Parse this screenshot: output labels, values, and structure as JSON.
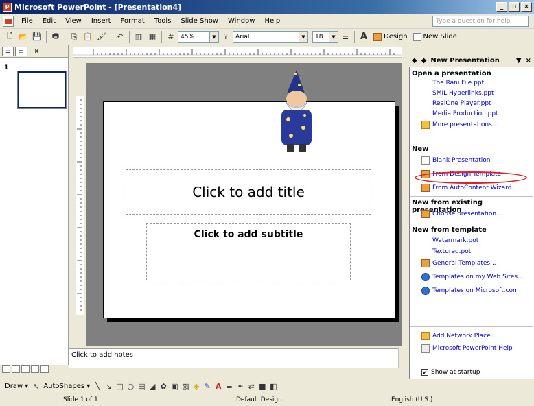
{
  "window": {
    "title": "Microsoft PowerPoint - [Presentation4]"
  },
  "menu": {
    "items": [
      "File",
      "Edit",
      "View",
      "Insert",
      "Format",
      "Tools",
      "Slide Show",
      "Window",
      "Help"
    ],
    "ask_placeholder": "Type a question for help"
  },
  "toolbar": {
    "zoom": "45%",
    "font": "Arial",
    "font_size": "18",
    "design_label": "Design",
    "new_slide_label": "New Slide"
  },
  "slide": {
    "title_placeholder": "Click to add title",
    "subtitle_placeholder": "Click to add subtitle",
    "thumbnail_number": "1"
  },
  "notes": {
    "placeholder": "Click to add notes"
  },
  "task_pane": {
    "title": "New Presentation",
    "open": {
      "heading": "Open a presentation",
      "files": [
        "The Rani File.ppt",
        "SMIL Hyperlinks.ppt",
        "RealOne Player.ppt",
        "Media Production.ppt"
      ],
      "more": "More presentations..."
    },
    "new": {
      "heading": "New",
      "blank": "Blank Presentation",
      "design_template": "From Design Template",
      "autocontent": "From AutoContent Wizard"
    },
    "existing": {
      "heading": "New from existing presentation",
      "choose": "Choose presentation..."
    },
    "template": {
      "heading": "New from template",
      "files": [
        "Watermark.pot",
        "Textured.pot"
      ],
      "general": "General Templates...",
      "web": "Templates on my Web Sites...",
      "microsoft": "Templates on Microsoft.com"
    },
    "bottom": {
      "network": "Add Network Place...",
      "help": "Microsoft PowerPoint Help",
      "startup": "Show at startup"
    }
  },
  "drawing": {
    "draw": "Draw",
    "autoshapes": "AutoShapes"
  },
  "status": {
    "slide": "Slide 1 of 1",
    "design": "Default Design",
    "language": "English (U.S.)"
  }
}
